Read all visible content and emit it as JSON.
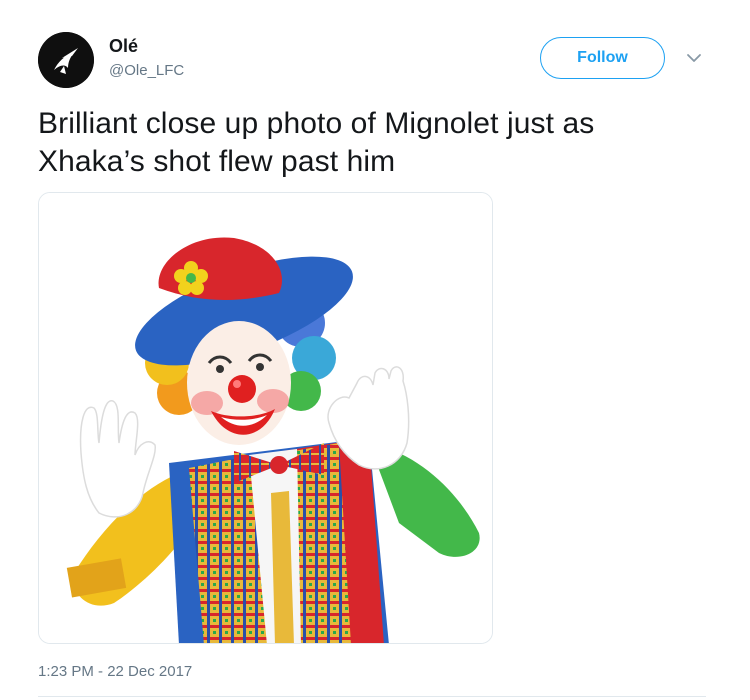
{
  "author": {
    "display_name": "Olé",
    "handle": "@Ole_LFC",
    "avatar_icon": "ole-logo-icon"
  },
  "follow_button": {
    "label": "Follow"
  },
  "menu": {
    "icon": "chevron-down-icon"
  },
  "tweet": {
    "text_line1": "Brilliant close up photo of Mignolet just as",
    "text_line2": "Xhaka’s shot flew past him",
    "media": {
      "subject": "clown-photo"
    },
    "timestamp": "1:23 PM - 22 Dec 2017"
  },
  "colors": {
    "accent": "#1da1f2",
    "secondary_text": "#657786",
    "primary_text": "#14171a",
    "border": "#e1e8ed"
  }
}
